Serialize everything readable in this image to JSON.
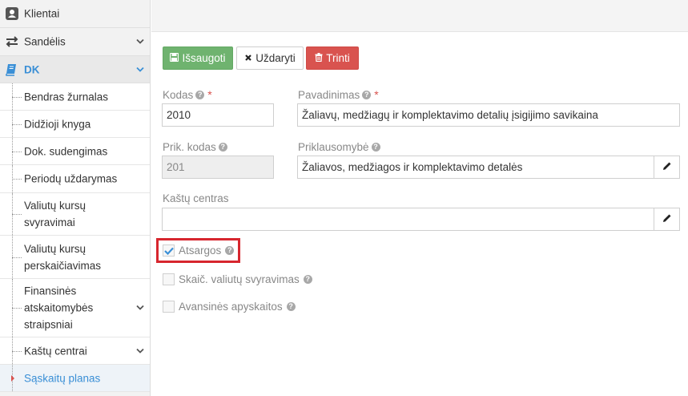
{
  "sidebar": {
    "top_items": [
      {
        "label": "Klientai",
        "icon": "user-icon"
      },
      {
        "label": "Sandėlis",
        "icon": "transfer-icon"
      },
      {
        "label": "DK",
        "icon": "book-icon"
      }
    ],
    "sub_items": [
      {
        "label": "Bendras žurnalas"
      },
      {
        "label": "Didžioji knyga"
      },
      {
        "label": "Dok. sudengimas"
      },
      {
        "label": "Periodų uždarymas"
      },
      {
        "label": "Valiutų kursų svyravimai"
      },
      {
        "label": "Valiutų kursų perskaičiavimas"
      },
      {
        "label": "Finansinės atskaitomybės straipsniai"
      },
      {
        "label": "Kaštų centrai"
      },
      {
        "label": "Sąskaitų planas"
      }
    ],
    "active_item": "Sąskaitų planas"
  },
  "toolbar": {
    "save_label": "Išsaugoti",
    "close_label": "Uždaryti",
    "delete_label": "Trinti"
  },
  "form": {
    "kodas": {
      "label": "Kodas",
      "value": "2010"
    },
    "pavadinimas": {
      "label": "Pavadinimas",
      "value": "Žaliavų, medžiagų ir komplektavimo detalių įsigijimo savikaina"
    },
    "prik_kodas": {
      "label": "Prik. kodas",
      "value": "201"
    },
    "priklausomybe": {
      "label": "Priklausomybė",
      "value": "Žaliavos, medžiagos ir komplektavimo detalės"
    },
    "kastu_centras": {
      "label": "Kaštų centras",
      "value": ""
    },
    "atsargos": {
      "label": "Atsargos",
      "checked": true
    },
    "skaic_valiutu": {
      "label": "Skaič. valiutų svyravimas",
      "checked": false
    },
    "avansines": {
      "label": "Avansinės apyskaitos",
      "checked": false
    }
  },
  "colors": {
    "accent": "#3a8fd6",
    "save": "#6fb36f",
    "delete": "#d9534f",
    "highlight": "#d7262e"
  }
}
